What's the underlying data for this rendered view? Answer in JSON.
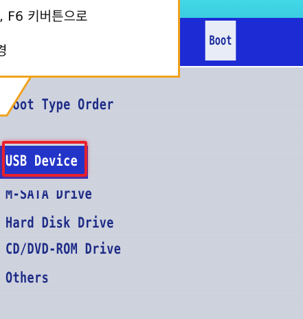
{
  "callout": {
    "line1": ", F6 키버튼으로",
    "line2": "경"
  },
  "tabs": {
    "active": "Boot"
  },
  "boot_menu": {
    "section_title": "Boot Type Order",
    "options": [
      "USB Device",
      "M-SATA Drive",
      "Hard Disk Drive",
      "CD/DVD-ROM Drive",
      "Others"
    ],
    "selected_index": 0
  },
  "colors": {
    "highlight": "#e8202b",
    "callout_border": "#f0a21c",
    "bios_text": "#1d2b86",
    "selected_bg": "#2335c8"
  }
}
